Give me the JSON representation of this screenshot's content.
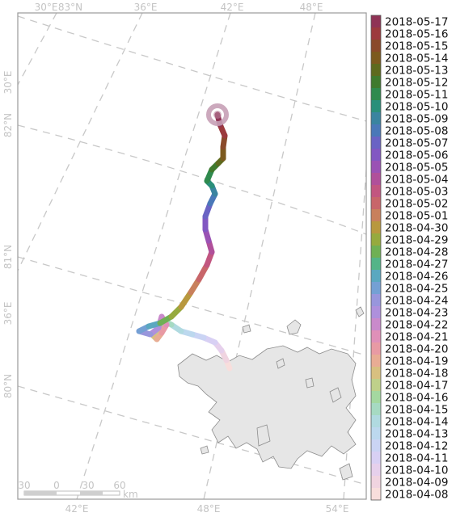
{
  "map": {
    "graticule_labels": {
      "top": [
        "30°E",
        "83°N",
        "36°E",
        "42°E",
        "48°E"
      ],
      "bottom": [
        "42°E",
        "48°E",
        "54°E"
      ],
      "left": [
        "30°E",
        "82°N",
        "81°N",
        "36°E",
        "80°N"
      ]
    },
    "scale_bar": {
      "ticks": [
        "30",
        "0",
        "30",
        "60"
      ],
      "unit": "km"
    }
  },
  "legend": {
    "dates": [
      "2018-05-17",
      "2018-05-16",
      "2018-05-15",
      "2018-05-14",
      "2018-05-13",
      "2018-05-12",
      "2018-05-11",
      "2018-05-10",
      "2018-05-09",
      "2018-05-08",
      "2018-05-07",
      "2018-05-06",
      "2018-05-05",
      "2018-05-04",
      "2018-05-03",
      "2018-05-02",
      "2018-05-01",
      "2018-04-30",
      "2018-04-29",
      "2018-04-28",
      "2018-04-27",
      "2018-04-26",
      "2018-04-25",
      "2018-04-24",
      "2018-04-23",
      "2018-04-22",
      "2018-04-21",
      "2018-04-20",
      "2018-04-19",
      "2018-04-18",
      "2018-04-17",
      "2018-04-16",
      "2018-04-15",
      "2018-04-14",
      "2018-04-13",
      "2018-04-12",
      "2018-04-11",
      "2018-04-10",
      "2018-04-09",
      "2018-04-08"
    ],
    "colors": [
      "#8f3355",
      "#9c3a3d",
      "#8a4a2a",
      "#7c5a1e",
      "#5e6a1e",
      "#3f7a2e",
      "#2f8a4e",
      "#2a8f7a",
      "#3a84a0",
      "#4a78b8",
      "#6a63c4",
      "#8257c2",
      "#9a52b4",
      "#b0509a",
      "#c25680",
      "#c8666a",
      "#c8805c",
      "#b8983e",
      "#96aa3e",
      "#6fb054",
      "#54b488",
      "#5aa8c0",
      "#74a0d4",
      "#9896dc",
      "#ae90dc",
      "#c98acb",
      "#df90b8",
      "#e89aa4",
      "#e8ac94",
      "#d8c080",
      "#bfd08a",
      "#a4d8a0",
      "#a6dac2",
      "#b0dae0",
      "#bcd8ee",
      "#cad4f4",
      "#d8d0f4",
      "#e6d0ec",
      "#f0d4e0",
      "#f8dedc"
    ]
  },
  "track": {
    "start_marker": "last-position-ring"
  }
}
